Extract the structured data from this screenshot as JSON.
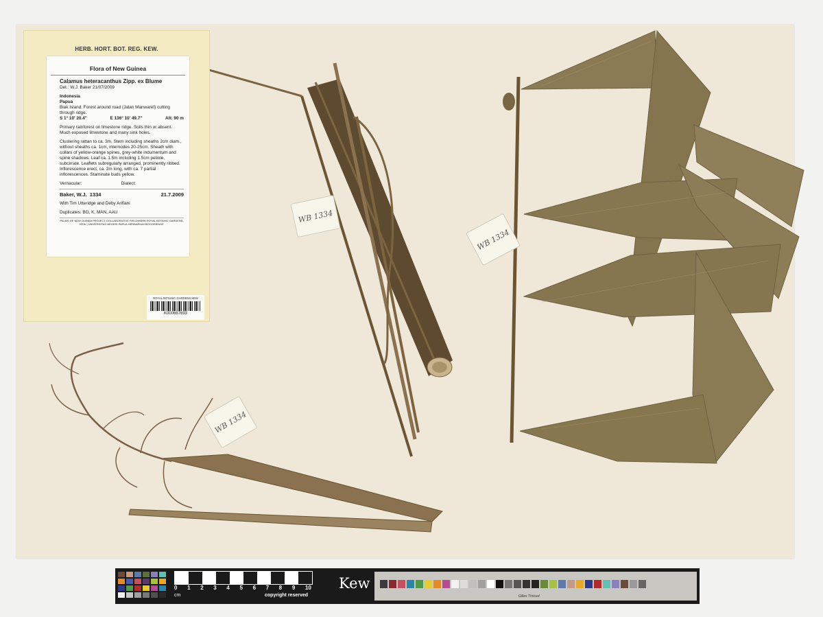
{
  "envelope": {
    "header": "HERB. HORT. BOT. REG. KEW."
  },
  "label": {
    "flora": "Flora of New Guinea",
    "taxon": "Calamus heteracanthus Zipp. ex Blume",
    "det": "Det.: W.J. Baker 21/07/2009",
    "country": "Indonesia",
    "region": "Papua",
    "locality": "Biak Island. Forest around road (Jalan Manwaref) cutting through ridge.",
    "lat": "S 1° 10' 20.4\"",
    "lon": "E 136° 10' 49.7\"",
    "alt": "Alt: 90 m",
    "habitat": "Primary rainforest on limestone ridge. Soils thin or absent. Much exposed limestone and many sink holes.",
    "description": "Clustering rattan to ca. 3m. Stem including sheaths 2cm diam., without sheaths ca. 1cm, internodes 20-25cm. Sheath with collars of yellow-orange spines, grey-white indumentum and spine shadows. Leaf ca. 1.5m including 1.5cm petiole, subcirrate. Leaflets subregularly arranged, prominently ribbed. Inflorescence erect, ca. 2m long, with ca. 7 partial inflorescences. Staminate buds yellow.",
    "vernacular": "Vernacular:",
    "dialect": "Dialect:",
    "collector": "Baker, W.J.",
    "number": "1334",
    "date": "21.7.2009",
    "with": "With Tim Utteridge and Deby Arifiani",
    "duplicates": "Duplicates: BO, K, MAN, AAU",
    "footnote": "PALMS OF NEW GUINEA PROJECT COLLABORATIVE FIELDWORK ROYAL BOTANIC GARDENS, KEW | UNIVERSITAS NEGERI PAPUA HERBARIUM BOGORIENSE"
  },
  "barcode": {
    "institution": "ROYAL BOTANIC GARDENS KEW",
    "number": "K000667693"
  },
  "tags": {
    "stem": "WB 1334",
    "leaf": "WB 1334",
    "inflorescence": "WB 1334"
  },
  "scale_bar": {
    "numbers": [
      "0",
      "1",
      "2",
      "3",
      "4",
      "5",
      "6",
      "7",
      "8",
      "9",
      "10"
    ],
    "unit": "cm",
    "copyright": "copyright reserved",
    "logo": "Kew",
    "kodak_brand": "Gilles Thriced"
  },
  "colors": {
    "sheet": "#efe8d8",
    "leaflet": "#8a7b55",
    "stem": "#6b5533"
  }
}
